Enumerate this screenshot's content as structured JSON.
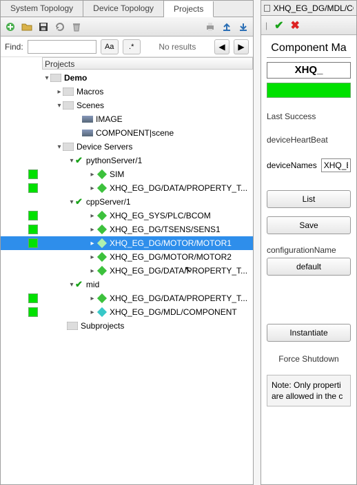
{
  "left": {
    "tabs": [
      "System Topology",
      "Device Topology",
      "Projects"
    ],
    "active_tab": 2,
    "find_label": "Find:",
    "find_value": "",
    "case_label": "Aa",
    "regex_label": ".*",
    "no_results": "No results",
    "prev": "◀",
    "next": "▶",
    "tree_header": "Projects",
    "tree_root": "Demo",
    "macros": "Macros",
    "scenes": "Scenes",
    "scene_items": [
      "IMAGE",
      "COMPONENT|scene"
    ],
    "device_servers": "Device Servers",
    "servers": [
      {
        "name": "pythonServer/1",
        "devices": [
          "SIM",
          "XHQ_EG_DG/DATA/PROPERTY_T..."
        ]
      },
      {
        "name": "cppServer/1",
        "devices": [
          "XHQ_EG_SYS/PLC/BCOM",
          "XHQ_EG_DG/TSENS/SENS1",
          "XHQ_EG_DG/MOTOR/MOTOR1",
          "XHQ_EG_DG/MOTOR/MOTOR2",
          "XHQ_EG_DG/DATA/PROPERTY_T..."
        ]
      },
      {
        "name": "mid",
        "devices": [
          "XHQ_EG_DG/DATA/PROPERTY_T...",
          "XHQ_EG_DG/MDL/COMPONENT"
        ]
      }
    ],
    "subprojects": "Subprojects"
  },
  "right": {
    "tab_title": "XHQ_EG_DG/MDL/CO",
    "section_title": "Component Ma",
    "device_name": "XHQ_",
    "last_success": "Last Success",
    "heartbeat": "deviceHeartBeat",
    "device_names_label": "deviceNames",
    "device_names_value": "XHQ_EG",
    "btn_list": "List",
    "btn_save": "Save",
    "config_label": "configurationName",
    "config_value": "default",
    "btn_instantiate": "Instantiate",
    "btn_force": "Force Shutdown",
    "note": "Note: Only properti\nare allowed in the c"
  }
}
